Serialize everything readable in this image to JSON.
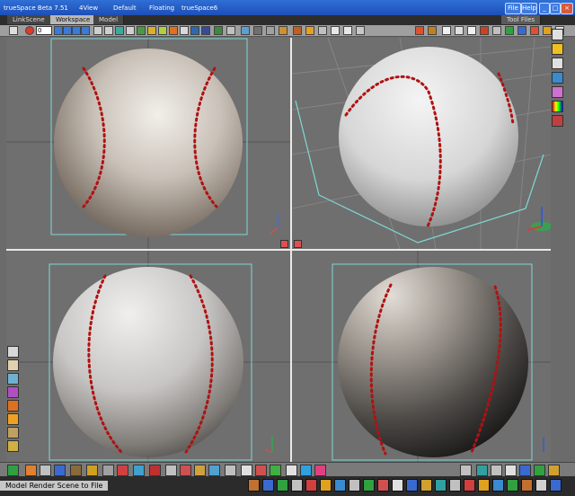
{
  "window": {
    "title": "trueSpace Beta 7.51",
    "tabs": [
      "4View",
      "Default",
      "Floating",
      "trueSpace6"
    ],
    "menu_file": "File",
    "menu_help": "Help",
    "tool_files": "Tool Files"
  },
  "workspace_tabs": [
    {
      "label": "LinkScene",
      "active": false
    },
    {
      "label": "Workspace",
      "active": true
    },
    {
      "label": "Model",
      "active": false
    }
  ],
  "toolbar": {
    "frame_value": "0"
  },
  "viewports": {
    "top_left": "front-view",
    "top_right": "perspective-view",
    "bottom_left": "side-view",
    "bottom_right": "camera-view"
  },
  "status": {
    "text": "Model  Render Scene to File"
  },
  "colors": {
    "title_blue": "#1d4fb5",
    "viewport_gray": "#6f6f6f",
    "frame_cyan": "#7fd7d7",
    "seam_red": "#b01212"
  }
}
